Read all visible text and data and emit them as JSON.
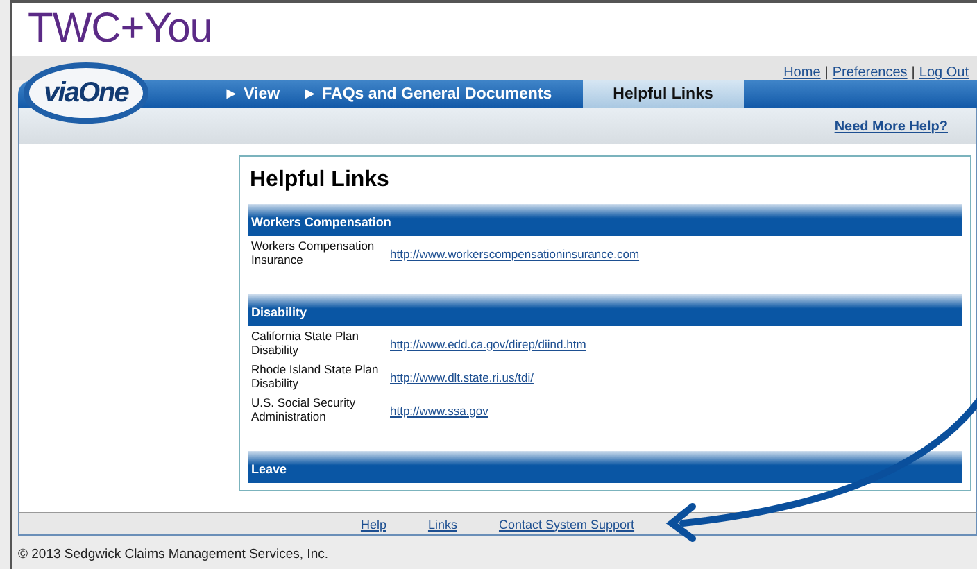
{
  "brand": "TWC+You",
  "top_links": [
    "Home",
    "Preferences",
    "Log Out"
  ],
  "top_link_separator": "|",
  "logo": "viaOne",
  "tabs": [
    {
      "label": "► View",
      "selected": false
    },
    {
      "label": "► FAQs and General Documents",
      "selected": false
    },
    {
      "label": "Helpful Links",
      "selected": true
    }
  ],
  "help_link": "Need More Help?",
  "card": {
    "title": "Helpful Links",
    "sections": [
      {
        "heading": "Workers Compensation",
        "rows": [
          {
            "label": "Workers Compensation Insurance",
            "url": "http://www.workerscompensationinsurance.com"
          }
        ]
      },
      {
        "heading": "Disability",
        "rows": [
          {
            "label": "California State Plan Disability",
            "url": "http://www.edd.ca.gov/direp/diind.htm"
          },
          {
            "label": "Rhode Island State Plan Disability",
            "url": "http://www.dlt.state.ri.us/tdi/"
          },
          {
            "label": "U.S. Social Security Administration",
            "url": "http://www.ssa.gov"
          }
        ]
      },
      {
        "heading": "Leave"
      }
    ]
  },
  "footer_links": [
    "Help",
    "Links",
    "Contact System Support"
  ],
  "copyright": "© 2013 Sedgwick Claims Management Services, Inc."
}
